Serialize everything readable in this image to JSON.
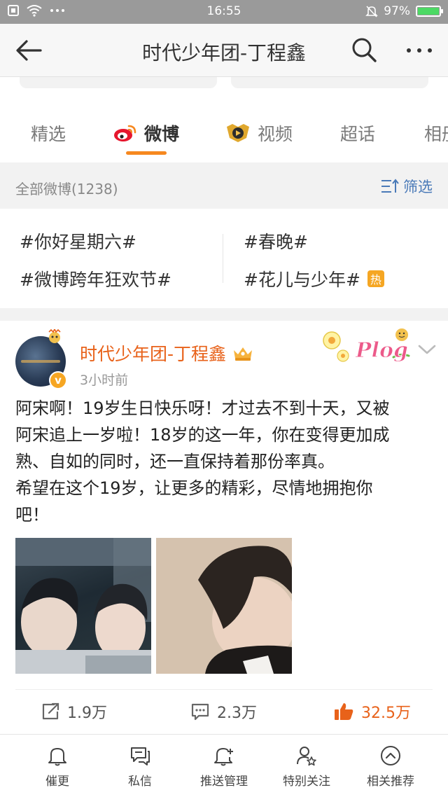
{
  "status_bar": {
    "time": "16:55",
    "battery": "97%"
  },
  "header": {
    "title": "时代少年团-丁程鑫"
  },
  "tabs": [
    {
      "label": "精选"
    },
    {
      "label": "微博"
    },
    {
      "label": "视频"
    },
    {
      "label": "超话"
    },
    {
      "label": "相册"
    }
  ],
  "filter_bar": {
    "count": "全部微博(1238)",
    "filter_label": "筛选"
  },
  "topics": [
    {
      "label": "#你好星期六#"
    },
    {
      "label": "#春晚#"
    },
    {
      "label": "#微博跨年狂欢节#"
    },
    {
      "label": "#花儿与少年#",
      "badge": "热"
    }
  ],
  "post": {
    "author": "时代少年团-丁程鑫",
    "verified_badge": "v",
    "time": "3小时前",
    "sticker_text": "Plog",
    "text_lines": [
      "阿宋啊！19岁生日快乐呀！才过去不到十天，又被",
      "阿宋追上一岁啦！18岁的这一年，你在变得更加成",
      "熟、自如的同时，还一直保持着那份率真。",
      "希望在这个19岁，让更多的精彩，尽情地拥抱你",
      "吧！"
    ],
    "reposts": "1.9万",
    "comments": "2.3万",
    "likes": "32.5万"
  },
  "bottom_nav": [
    {
      "label": "催更",
      "icon": "bell-icon"
    },
    {
      "label": "私信",
      "icon": "message-icon"
    },
    {
      "label": "推送管理",
      "icon": "bell-plus-icon"
    },
    {
      "label": "特别关注",
      "icon": "user-star-icon"
    },
    {
      "label": "相关推荐",
      "icon": "chevron-up-circle-icon"
    }
  ],
  "colors": {
    "accent": "#f6881f",
    "name": "#e8621a",
    "link": "#4a7ab8"
  }
}
